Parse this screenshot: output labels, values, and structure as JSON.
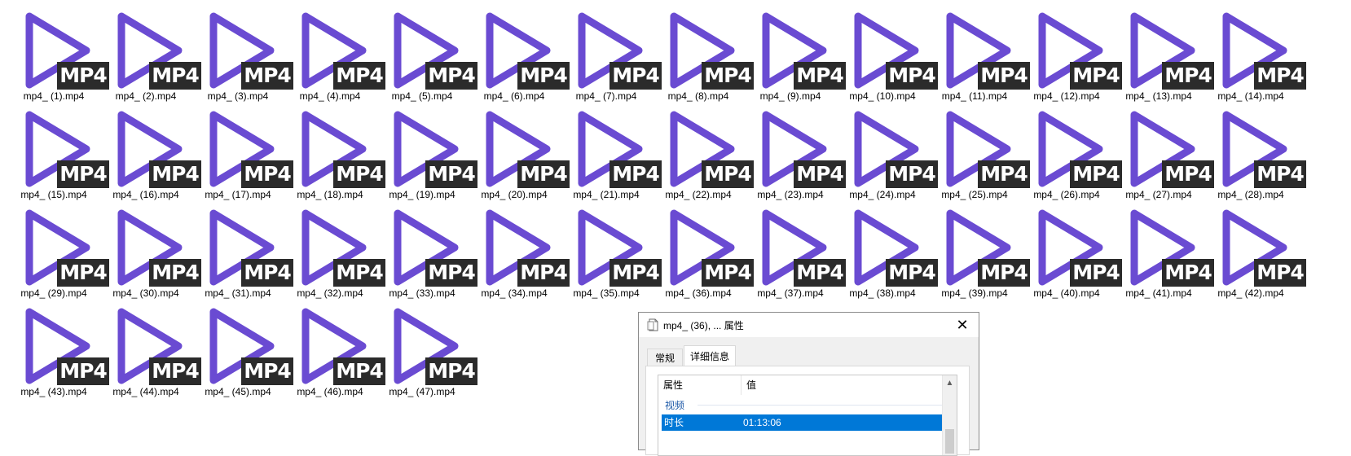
{
  "colors": {
    "play_icon": "#6a4bd2",
    "badge_bg": "#2b2b2b",
    "selection": "#0078d7"
  },
  "badge_text": "MP4",
  "files": [
    "mp4_ (1).mp4",
    "mp4_ (2).mp4",
    "mp4_ (3).mp4",
    "mp4_ (4).mp4",
    "mp4_ (5).mp4",
    "mp4_ (6).mp4",
    "mp4_ (7).mp4",
    "mp4_ (8).mp4",
    "mp4_ (9).mp4",
    "mp4_ (10).mp4",
    "mp4_ (11).mp4",
    "mp4_ (12).mp4",
    "mp4_ (13).mp4",
    "mp4_ (14).mp4",
    "mp4_ (15).mp4",
    "mp4_ (16).mp4",
    "mp4_ (17).mp4",
    "mp4_ (18).mp4",
    "mp4_ (19).mp4",
    "mp4_ (20).mp4",
    "mp4_ (21).mp4",
    "mp4_ (22).mp4",
    "mp4_ (23).mp4",
    "mp4_ (24).mp4",
    "mp4_ (25).mp4",
    "mp4_ (26).mp4",
    "mp4_ (27).mp4",
    "mp4_ (28).mp4",
    "mp4_ (29).mp4",
    "mp4_ (30).mp4",
    "mp4_ (31).mp4",
    "mp4_ (32).mp4",
    "mp4_ (33).mp4",
    "mp4_ (34).mp4",
    "mp4_ (35).mp4",
    "mp4_ (36).mp4",
    "mp4_ (37).mp4",
    "mp4_ (38).mp4",
    "mp4_ (39).mp4",
    "mp4_ (40).mp4",
    "mp4_ (41).mp4",
    "mp4_ (42).mp4",
    "mp4_ (43).mp4",
    "mp4_ (44).mp4",
    "mp4_ (45).mp4",
    "mp4_ (46).mp4",
    "mp4_ (47).mp4"
  ],
  "dialog": {
    "title": "mp4_ (36), ... 属性",
    "close_icon": "close-icon",
    "tabs": [
      {
        "label": "常规",
        "active": false
      },
      {
        "label": "详细信息",
        "active": true
      }
    ],
    "columns": {
      "property": "属性",
      "value": "值"
    },
    "group": "视频",
    "selected_row": {
      "name": "时长",
      "value": "01:13:06"
    }
  }
}
